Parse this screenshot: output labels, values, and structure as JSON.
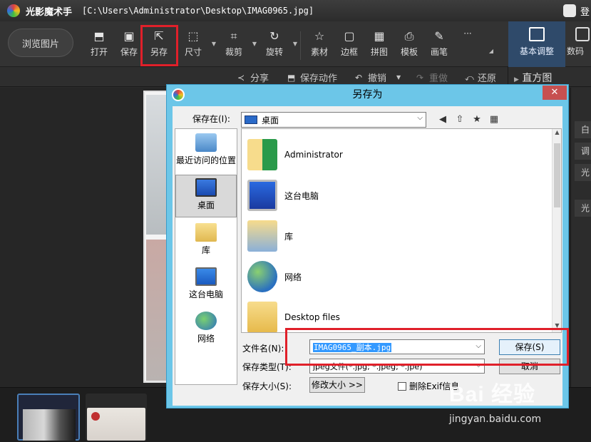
{
  "titlebar": {
    "app_name": "光影魔术手",
    "path": "[C:\\Users\\Administrator\\Desktop\\IMAG0965.jpg]",
    "login": "登"
  },
  "toolbar": {
    "browse": "浏览图片",
    "tools": [
      {
        "label": "打开",
        "icon": "open-icon"
      },
      {
        "label": "保存",
        "icon": "save-icon"
      },
      {
        "label": "另存",
        "icon": "save-as-icon"
      },
      {
        "label": "尺寸",
        "icon": "resize-icon"
      },
      {
        "label": "裁剪",
        "icon": "crop-icon"
      },
      {
        "label": "旋转",
        "icon": "rotate-icon"
      },
      {
        "label": "素材",
        "icon": "star-icon"
      },
      {
        "label": "边框",
        "icon": "border-icon"
      },
      {
        "label": "拼图",
        "icon": "grid-icon"
      },
      {
        "label": "模板",
        "icon": "template-icon"
      },
      {
        "label": "画笔",
        "icon": "brush-icon"
      },
      {
        "label": "···",
        "icon": "more-icon"
      }
    ],
    "tab_basic": "基本调整",
    "tab_num": "数码"
  },
  "subbar": {
    "share": "分享",
    "save_action": "保存动作",
    "undo": "撤销",
    "redo": "重做",
    "restore": "还原",
    "histogram": "直方图"
  },
  "right_panel": [
    "白",
    "调",
    "光",
    "光"
  ],
  "dialog": {
    "title": "另存为",
    "close": "✕",
    "save_in_label": "保存在(I):",
    "save_in_value": "桌面",
    "places": [
      {
        "label": "最近访问的位置",
        "icon": "recent-places-icon"
      },
      {
        "label": "桌面",
        "icon": "desktop-icon"
      },
      {
        "label": "库",
        "icon": "library-icon"
      },
      {
        "label": "这台电脑",
        "icon": "computer-icon"
      },
      {
        "label": "网络",
        "icon": "network-icon"
      }
    ],
    "files": [
      {
        "name": "Administrator",
        "icon": "user-folder-icon"
      },
      {
        "name": "这台电脑",
        "icon": "computer-icon"
      },
      {
        "name": "库",
        "icon": "library-icon"
      },
      {
        "name": "网络",
        "icon": "network-icon"
      },
      {
        "name": "Desktop files",
        "icon": "folder-icon"
      }
    ],
    "filename_label": "文件名(N):",
    "filename_value": "IMAG0965_副本.jpg",
    "filetype_label": "保存类型(T):",
    "filetype_value": "jpeg文件(*.jpg; *.jpeg; *.jpe)",
    "size_label": "保存大小(S):",
    "resize_button": "修改大小 >>",
    "exif_label": "删除Exif信息",
    "save_button": "保存(S)",
    "cancel_button": "取消"
  },
  "watermark": {
    "logo": "Bai 经验",
    "url": "jingyan.baidu.com"
  },
  "colors": {
    "highlight": "#e0202a",
    "dialog_frame": "#6cc6e8",
    "selection": "#3399ff"
  }
}
